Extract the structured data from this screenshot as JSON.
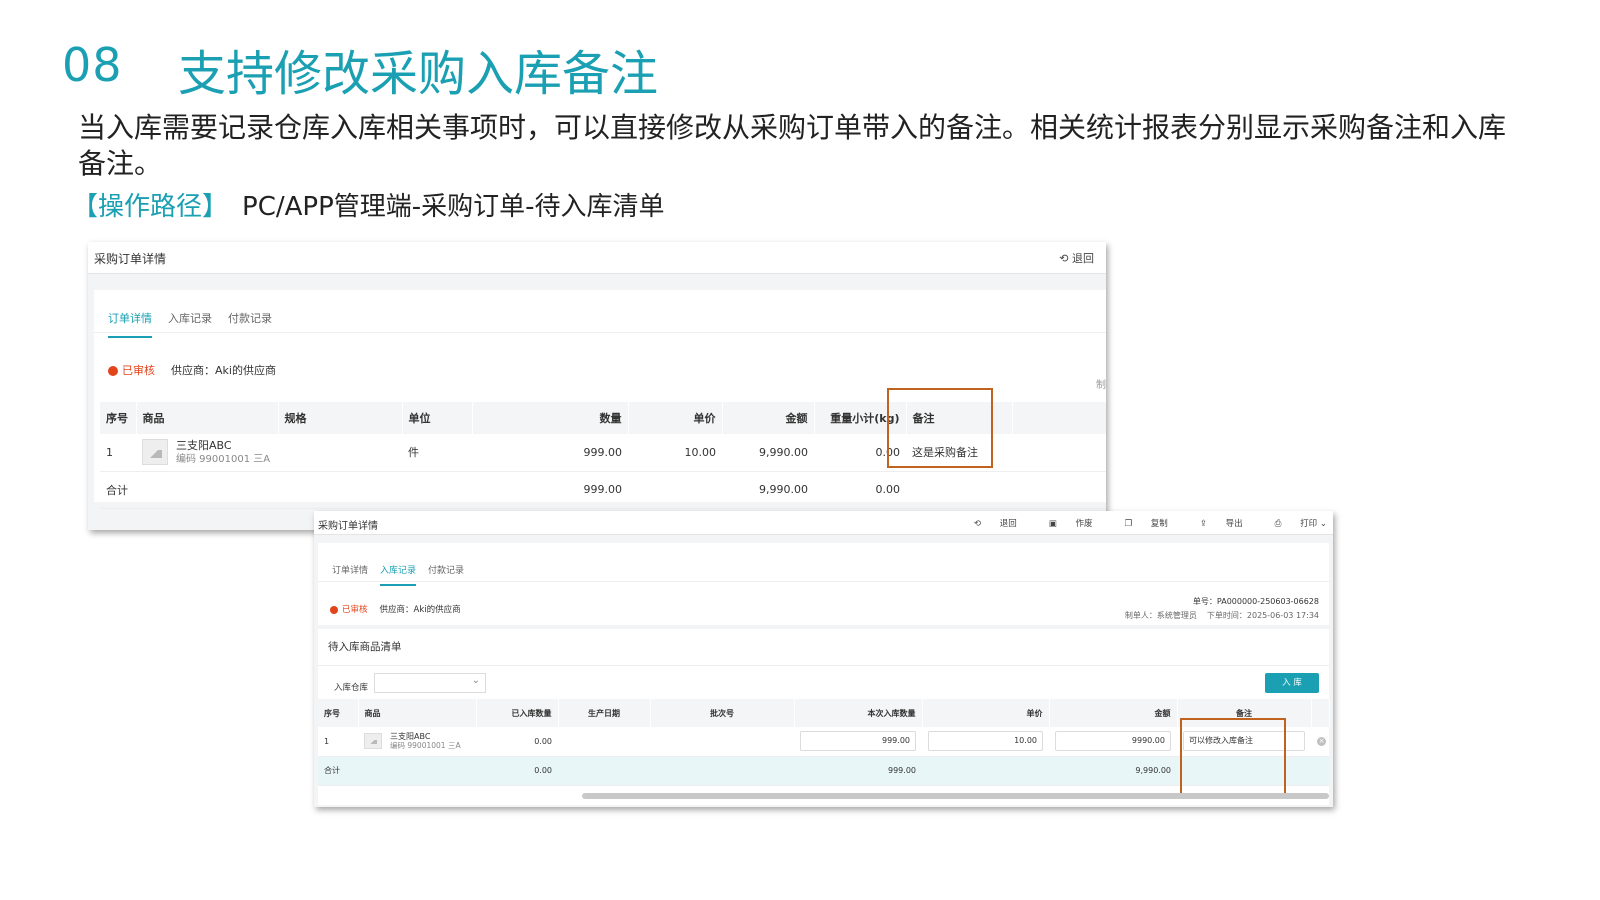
{
  "slide": {
    "number": "08",
    "title": "支持修改采购入库备注",
    "description": "当入库需要记录仓库入库相关事项时，可以直接修改从采购订单带入的备注。相关统计报表分别显示采购备注和入库备注。",
    "path_label": "【操作路径】",
    "path_value": "PC/APP管理端-采购订单-待入库清单"
  },
  "panel1": {
    "title": "采购订单详情",
    "back": "退回",
    "tabs": [
      "订单详情",
      "入库记录",
      "付款记录"
    ],
    "status": "已审核",
    "supplier": "供应商：Aki的供应商",
    "cut_text": "制",
    "columns": [
      "序号",
      "商品",
      "规格",
      "单位",
      "数量",
      "单价",
      "金额",
      "重量小计(kg)",
      "备注"
    ],
    "row": {
      "index": "1",
      "product_name": "三支阳ABC",
      "product_code": "编码  99001001  三A",
      "spec": "",
      "unit": "件",
      "qty": "999.00",
      "price": "10.00",
      "amount": "9,990.00",
      "weight": "0.00",
      "remark": "这是采购备注"
    },
    "total": {
      "label": "合计",
      "qty": "999.00",
      "amount": "9,990.00",
      "weight": "0.00"
    }
  },
  "panel2": {
    "title": "采购订单详情",
    "actions": [
      "退回",
      "作废",
      "复制",
      "导出",
      "打印 ⌄"
    ],
    "tabs": [
      "订单详情",
      "入库记录",
      "付款记录"
    ],
    "status": "已审核",
    "supplier": "供应商：Aki的供应商",
    "order_no": "单号：PA000000-250603-06628",
    "creator": "制单人：系统管理员",
    "order_time": "下单时间：2025-06-03 17:34",
    "section_title": "待入库商品清单",
    "warehouse_label": "入库仓库",
    "warehouse_value": "",
    "in_button": "入 库",
    "columns": [
      "序号",
      "商品",
      "已入库数量",
      "生产日期",
      "批次号",
      "本次入库数量",
      "单价",
      "金额",
      "备注"
    ],
    "row": {
      "index": "1",
      "product_name": "三支阳ABC",
      "product_code": "编码  99001001  三A",
      "stocked": "0.00",
      "prod_date": "",
      "batch": "",
      "this_qty": "999.00",
      "price": "10.00",
      "amount": "9990.00",
      "remark": "可以修改入库备注"
    },
    "total": {
      "label": "合计",
      "stocked": "0.00",
      "this_qty": "999.00",
      "amount": "9,990.00"
    }
  },
  "colors": {
    "accent": "#1aa0b2",
    "highlight": "#c0631e",
    "status": "#e2441b"
  },
  "icons": [
    "undo-icon",
    "void-icon",
    "copy-icon",
    "export-icon",
    "print-icon",
    "clear-icon",
    "image-placeholder-icon"
  ]
}
